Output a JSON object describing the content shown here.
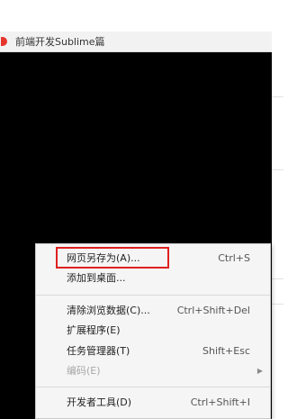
{
  "tab": {
    "title": "前端开发Sublime篇",
    "favicon_color": "#e5352c"
  },
  "context_menu": {
    "items": [
      {
        "label": "网页另存为(A)...",
        "shortcut": "Ctrl+S"
      },
      {
        "label": "添加到桌面..."
      },
      {
        "label": "清除浏览数据(C)...",
        "shortcut": "Ctrl+Shift+Del"
      },
      {
        "label": "扩展程序(E)"
      },
      {
        "label": "任务管理器(T)",
        "shortcut": "Shift+Esc"
      },
      {
        "label": "编码(E)",
        "disabled": true,
        "submenu_icon": "chevron-right-icon"
      },
      {
        "label": "开发者工具(D)",
        "shortcut": "Ctrl+Shift+I"
      }
    ]
  },
  "annotation": {
    "highlight_color": "#e02020"
  }
}
